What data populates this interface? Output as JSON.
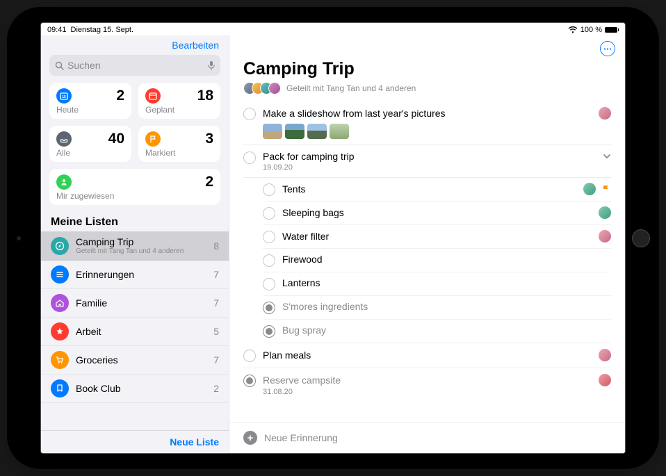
{
  "status": {
    "time": "09:41",
    "date": "Dienstag 15. Sept.",
    "battery": "100 %"
  },
  "sidebar": {
    "edit": "Bearbeiten",
    "search": {
      "placeholder": "Suchen"
    },
    "smart": {
      "today": {
        "label": "Heute",
        "count": "2",
        "color": "#007aff"
      },
      "scheduled": {
        "label": "Geplant",
        "count": "18",
        "color": "#ff3b30"
      },
      "all": {
        "label": "Alle",
        "count": "40",
        "color": "#5b6670"
      },
      "flagged": {
        "label": "Markiert",
        "count": "3",
        "color": "#ff9500"
      },
      "assigned": {
        "label": "Mir zugewiesen",
        "count": "2",
        "color": "#30d158"
      }
    },
    "listsTitle": "Meine Listen",
    "lists": [
      {
        "name": "Camping Trip",
        "sub": "Geteilt mit Tang Tan und 4 anderen",
        "count": "8",
        "color": "#2aa8a8",
        "selected": true,
        "icon": "compass"
      },
      {
        "name": "Erinnerungen",
        "sub": "",
        "count": "7",
        "color": "#007aff",
        "icon": "list"
      },
      {
        "name": "Familie",
        "sub": "",
        "count": "7",
        "color": "#af52de",
        "icon": "house"
      },
      {
        "name": "Arbeit",
        "sub": "",
        "count": "5",
        "color": "#ff3b30",
        "icon": "star"
      },
      {
        "name": "Groceries",
        "sub": "",
        "count": "7",
        "color": "#ff9500",
        "icon": "cart"
      },
      {
        "name": "Book Club",
        "sub": "",
        "count": "2",
        "color": "#007aff",
        "icon": "bookmark"
      }
    ],
    "newList": "Neue Liste"
  },
  "detail": {
    "title": "Camping Trip",
    "sharedText": "Geteilt mit Tang Tan und 4 anderen",
    "newReminder": "Neue Erinnerung"
  },
  "reminders": [
    {
      "title": "Make a slideshow from last year's pictures",
      "done": false,
      "assignee": "aa",
      "thumbs": true
    },
    {
      "title": "Pack for camping trip",
      "date": "19.09.20",
      "done": false,
      "expanded": true,
      "sub": [
        {
          "title": "Tents",
          "done": false,
          "assignee": "ab",
          "flag": true
        },
        {
          "title": "Sleeping bags",
          "done": false,
          "assignee": "ab"
        },
        {
          "title": "Water filter",
          "done": false,
          "assignee": "aa"
        },
        {
          "title": "Firewood",
          "done": false
        },
        {
          "title": "Lanterns",
          "done": false
        },
        {
          "title": "S'mores ingredients",
          "done": true
        },
        {
          "title": "Bug spray",
          "done": true
        }
      ]
    },
    {
      "title": "Plan meals",
      "done": false,
      "assignee": "aa"
    },
    {
      "title": "Reserve campsite",
      "date": "31.08.20",
      "done": true,
      "assignee": "ad"
    }
  ]
}
